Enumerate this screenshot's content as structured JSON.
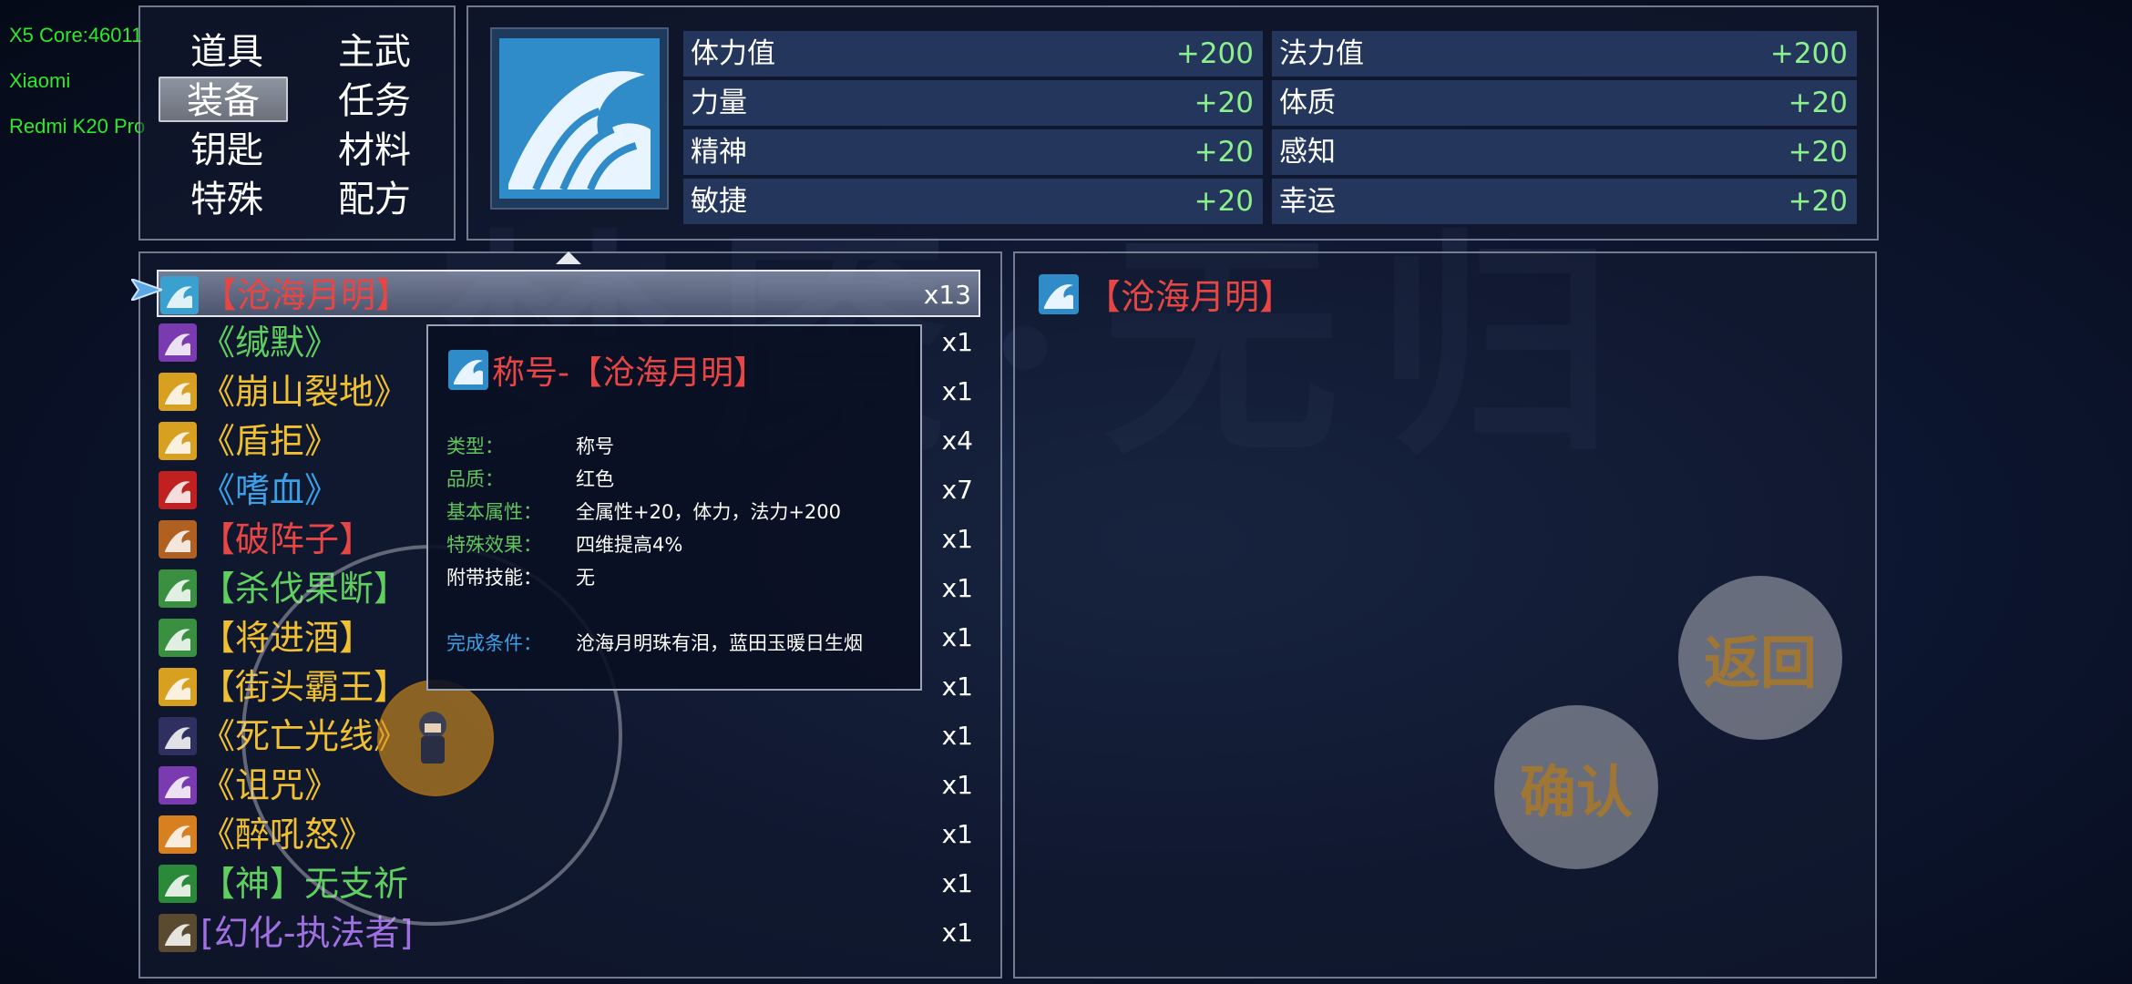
{
  "debug": [
    "X5 Core:46011",
    "Xiaomi",
    "Redmi K20 Pro"
  ],
  "categories": [
    {
      "label": "道具",
      "active": false
    },
    {
      "label": "主武",
      "active": false
    },
    {
      "label": "装备",
      "active": true
    },
    {
      "label": "任务",
      "active": false
    },
    {
      "label": "钥匙",
      "active": false
    },
    {
      "label": "材料",
      "active": false
    },
    {
      "label": "特殊",
      "active": false
    },
    {
      "label": "配方",
      "active": false
    }
  ],
  "stats": [
    {
      "name": "体力值",
      "value": "+200"
    },
    {
      "name": "法力值",
      "value": "+200"
    },
    {
      "name": "力量",
      "value": "+20"
    },
    {
      "name": "体质",
      "value": "+20"
    },
    {
      "name": "精神",
      "value": "+20"
    },
    {
      "name": "感知",
      "value": "+20"
    },
    {
      "name": "敏捷",
      "value": "+20"
    },
    {
      "name": "幸运",
      "value": "+20"
    }
  ],
  "items": [
    {
      "name": "【沧海月明】",
      "qty": "x13",
      "color": "#e84545",
      "icon_color": "#3aa0d0",
      "icon": "wave-icon"
    },
    {
      "name": "《缄默》",
      "qty": "x1",
      "color": "#5fd05f",
      "icon_color": "#7a3ab0",
      "icon": "mute-mask-icon"
    },
    {
      "name": "《崩山裂地》",
      "qty": "x1",
      "color": "#f0c030",
      "icon_color": "#d8a020",
      "icon": "mountain-crack-icon"
    },
    {
      "name": "《盾拒》",
      "qty": "x4",
      "color": "#f0c030",
      "icon_color": "#d8a020",
      "icon": "shield-icon"
    },
    {
      "name": "《嗜血》",
      "qty": "x7",
      "color": "#3aa0e8",
      "icon_color": "#c02020",
      "icon": "blood-blade-icon"
    },
    {
      "name": "【破阵子】",
      "qty": "x1",
      "color": "#e84545",
      "icon_color": "#b06020",
      "icon": "formation-icon"
    },
    {
      "name": "【杀伐果断】",
      "qty": "x1",
      "color": "#5fd05f",
      "icon_color": "#3a9040",
      "icon": "wings-icon"
    },
    {
      "name": "【将进酒】",
      "qty": "x1",
      "color": "#f0c030",
      "icon_color": "#3a9040",
      "icon": "wings-icon"
    },
    {
      "name": "【街头霸王】",
      "qty": "x1",
      "color": "#f0c030",
      "icon_color": "#d8a020",
      "icon": "lion-icon"
    },
    {
      "name": "《死亡光线》",
      "qty": "x1",
      "color": "#f0c030",
      "icon_color": "#303060",
      "icon": "death-ray-icon"
    },
    {
      "name": "《诅咒》",
      "qty": "x1",
      "color": "#f0c030",
      "icon_color": "#7a3ab0",
      "icon": "curse-skull-icon"
    },
    {
      "name": "《醉吼怒》",
      "qty": "x1",
      "color": "#f0c030",
      "icon_color": "#d88020",
      "icon": "roar-icon"
    },
    {
      "name": "【神】无支祈",
      "qty": "x1",
      "color": "#5fd05f",
      "icon_color": "#2a8a3a",
      "icon": "divine-seal-icon"
    },
    {
      "name": "[幻化-执法者]",
      "qty": "x1",
      "color": "#a070e0",
      "icon_color": "#5a4a30",
      "icon": "enforcer-portrait-icon"
    }
  ],
  "tooltip": {
    "title": "称号-【沧海月明】",
    "rows": [
      {
        "label": "类型：",
        "value": "称号"
      },
      {
        "label": "品质：",
        "value": "红色"
      },
      {
        "label": "基本属性：",
        "value": "全属性+20，体力，法力+200"
      },
      {
        "label": "特殊效果：",
        "value": "四维提高4%"
      },
      {
        "label": "附带技能：",
        "value": "无"
      },
      {
        "label": "完成条件：",
        "value": "沧海月明珠有泪，蓝田玉暖日生烟"
      }
    ]
  },
  "detail": {
    "title": "【沧海月明】"
  },
  "buttons": {
    "back": "返回",
    "confirm": "确认"
  },
  "colors": {
    "red": "#e84545",
    "green": "#5fd05f",
    "stat_value": "#8cf08c"
  }
}
